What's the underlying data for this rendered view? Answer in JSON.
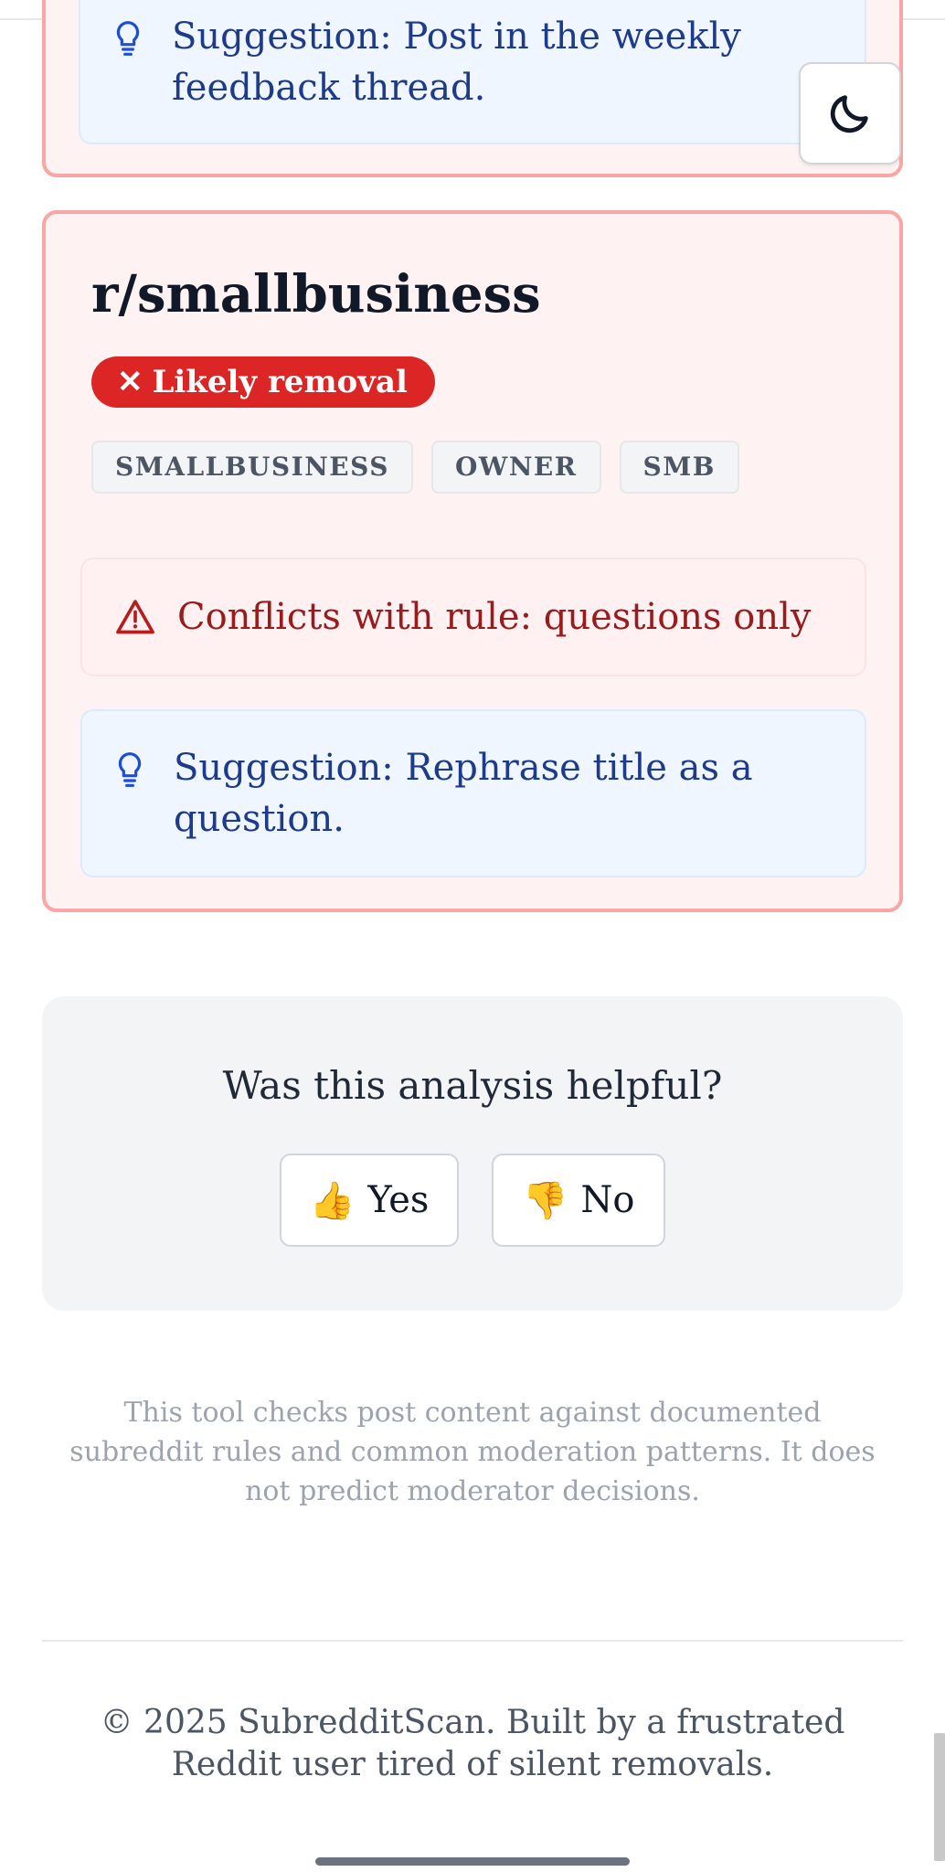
{
  "prev_card": {
    "suggestion": "Suggestion: Post in the weekly feedback thread."
  },
  "theme_toggle": {
    "icon": "moon-icon"
  },
  "card": {
    "subreddit": "r/smallbusiness",
    "status_icon": "✕",
    "status": "Likely removal",
    "tags": [
      "SMALLBUSINESS",
      "OWNER",
      "SMB"
    ],
    "conflict": "Conflicts with rule: questions only",
    "suggestion": "Suggestion: Rephrase title as a question."
  },
  "feedback": {
    "question": "Was this analysis helpful?",
    "yes_emoji": "👍",
    "yes_label": "Yes",
    "no_emoji": "👎",
    "no_label": "No"
  },
  "disclaimer": "This tool checks post content against documented subreddit rules and common moderation patterns. It does not predict moderator decisions.",
  "footer": "© 2025 SubredditScan. Built by a frustrated Reddit user tired of silent removals.",
  "colors": {
    "danger": "#dc2626",
    "danger_border": "#fca5a5",
    "suggest_text": "#1e3a8a",
    "conflict_text": "#991b1b"
  }
}
